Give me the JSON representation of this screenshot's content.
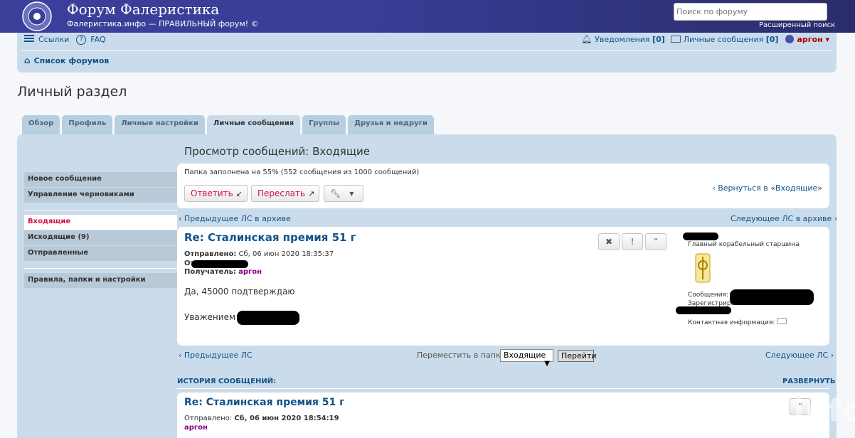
{
  "header": {
    "title": "Форум Фалеристика",
    "description": "Фалеристика.инфо — ПРАВИЛЬНЫЙ форум! ©",
    "search_placeholder": "Поиск по форуму",
    "advanced_search": "Расширенный поиск"
  },
  "navbar": {
    "links": "Ссылки",
    "faq": "FAQ",
    "notifications": "Уведомления",
    "notifications_count": "[0]",
    "private_messages": "Личные сообщения",
    "pm_count": "[0]",
    "username": "аргон",
    "breadcrumb": "Список форумов"
  },
  "page_title": "Личный раздел",
  "tabs": [
    "Обзор",
    "Профиль",
    "Личные настройки",
    "Личные сообщения",
    "Группы",
    "Друзья и недруги"
  ],
  "menu": {
    "new_message": "Новое сообщение",
    "drafts": "Управление черновиками",
    "inbox": "Входящие",
    "outbox": "Исходящие (9)",
    "sent": "Отправленные",
    "rules": "Правила, папки и настройки"
  },
  "content": {
    "title": "Просмотр сообщений: Входящие",
    "folder_info": "Папка заполнена на 55% (552 сообщения из 1000 сообщений)",
    "reply": "Ответить",
    "forward": "Переслать",
    "back_to_inbox": "Вернуться в «Входящие»",
    "prev_archive": "Предыдущее ЛС в архиве",
    "next_archive": "Следующее ЛС в архиве"
  },
  "message": {
    "subject": "Re: Сталинская премия 51 г",
    "sent_label": "Отправлено:",
    "sent_date": "Сб, 06 июн 2020 18:35:37",
    "from_label": "От",
    "to_label": "Получатель:",
    "to_user": "аргон",
    "body_line1": "Да, 45000 подтверждаю",
    "body_line2": "Уважением",
    "rank": "Главный корабельный старшина",
    "posts_label": "Сообщения:",
    "registered_label": "Зарегистрирован:",
    "contact_label": "Контактная информация:"
  },
  "bottom_nav": {
    "prev": "Предыдущее ЛС",
    "next": "Следующее ЛС",
    "move_label": "Переместить в папку:",
    "folder_value": "Входящие",
    "go": "Перейти"
  },
  "history": {
    "title": "ИСТОРИЯ СООБЩЕНИЙ:",
    "expand": "РАЗВЕРНУТЬ",
    "subject": "Re: Сталинская премия 51 г",
    "sent_label": "Отправлено:",
    "sent_date": "Сб, 06 июн 2020 18:54:19",
    "author": "аргон"
  },
  "watermark": "forum.faleristika.info"
}
